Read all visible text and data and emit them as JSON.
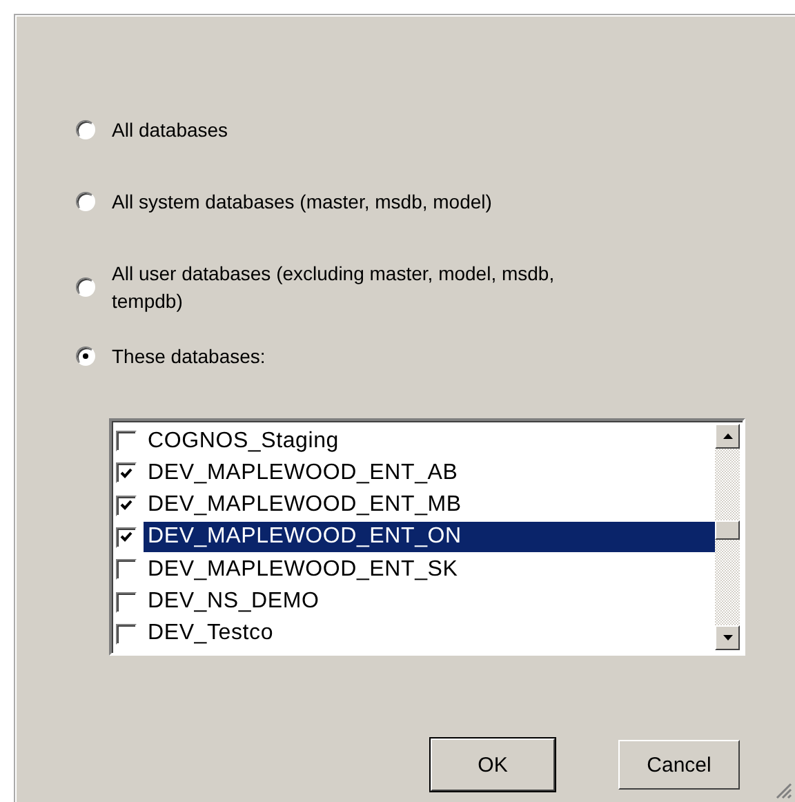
{
  "options": [
    {
      "label": "All databases",
      "selected": false
    },
    {
      "label": "All system databases (master, msdb, model)",
      "selected": false
    },
    {
      "label": "All user databases  (excluding master, model, msdb, tempdb)",
      "selected": false
    },
    {
      "label": "These databases:",
      "selected": true
    }
  ],
  "databases": [
    {
      "name": "COGNOS_Staging",
      "checked": false,
      "selected": false
    },
    {
      "name": "DEV_MAPLEWOOD_ENT_AB",
      "checked": true,
      "selected": false
    },
    {
      "name": "DEV_MAPLEWOOD_ENT_MB",
      "checked": true,
      "selected": false
    },
    {
      "name": "DEV_MAPLEWOOD_ENT_ON",
      "checked": true,
      "selected": true
    },
    {
      "name": "DEV_MAPLEWOOD_ENT_SK",
      "checked": false,
      "selected": false
    },
    {
      "name": "DEV_NS_DEMO",
      "checked": false,
      "selected": false
    },
    {
      "name": "DEV_Testco",
      "checked": false,
      "selected": false
    }
  ],
  "buttons": [
    {
      "label": "OK",
      "kind": "default"
    },
    {
      "label": "Cancel",
      "kind": "normal"
    }
  ]
}
